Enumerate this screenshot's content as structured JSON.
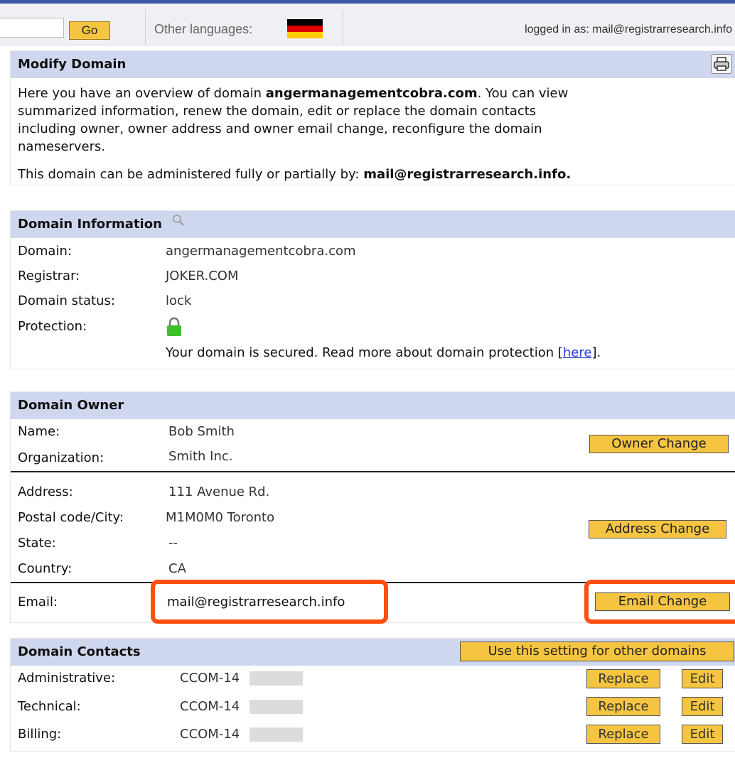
{
  "topbar": {
    "go_label": "Go",
    "other_languages_label": "Other languages:",
    "flag_colors": [
      "#000000",
      "#dd0000",
      "#ffcc00"
    ],
    "logged_in_text": "logged in as: mail@registrarresearch.info"
  },
  "modify": {
    "title": "Modify Domain",
    "print_icon": "printer-icon",
    "intro_prefix": "Here you have an overview of domain ",
    "domain_bold": "angermanagementcobra.com",
    "intro_line1_suffix": ". You can view",
    "intro_line2": "summarized information, renew the domain, edit or replace the domain contacts",
    "intro_line3": "including owner, owner address and owner email change, reconfigure the domain",
    "intro_line4": "nameservers.",
    "admin_prefix": "This domain can be administered fully or partially by: ",
    "admin_email": "mail@registrarresearch.info."
  },
  "info": {
    "title": "Domain Information",
    "search_icon": "magnifier-icon",
    "rows": [
      {
        "label": "Domain:",
        "value": "angermanagementcobra.com"
      },
      {
        "label": "Registrar:",
        "value": "JOKER.COM"
      },
      {
        "label": "Domain status:",
        "value": "lock"
      },
      {
        "label": "Protection:",
        "value": ""
      }
    ],
    "lock_icon": "green-lock-icon",
    "protection_prefix": "Your domain is secured. Read more about domain protection [",
    "protection_link": "here",
    "protection_suffix": "]."
  },
  "owner": {
    "title": "Domain Owner",
    "name_label": "Name:",
    "name_value": "Bob Smith",
    "org_label": "Organization:",
    "org_value": "Smith Inc.",
    "owner_change": "Owner Change",
    "address_label": "Address:",
    "address_value": "111 Avenue Rd.",
    "postal_label": "Postal code/City:",
    "postal_value": "M1M0M0 Toronto",
    "state_label": "State:",
    "state_value": "--",
    "country_label": "Country:",
    "country_value": "CA",
    "address_change": "Address Change",
    "email_label": "Email:",
    "email_value": "mail@registrarresearch.info",
    "email_change": "Email Change"
  },
  "contacts": {
    "title": "Domain Contacts",
    "use_setting": "Use this setting for other domains",
    "rows": [
      {
        "label": "Administrative:",
        "value": "CCOM-14",
        "replace": "Replace",
        "edit": "Edit"
      },
      {
        "label": "Technical:",
        "value": "CCOM-14",
        "replace": "Replace",
        "edit": "Edit"
      },
      {
        "label": "Billing:",
        "value": "CCOM-14",
        "replace": "Replace",
        "edit": "Edit"
      }
    ]
  },
  "colors": {
    "header_bg": "#cfd7ee",
    "button_bg": "#f5c542",
    "callout": "#ff5010",
    "link": "#2a3fd6"
  }
}
